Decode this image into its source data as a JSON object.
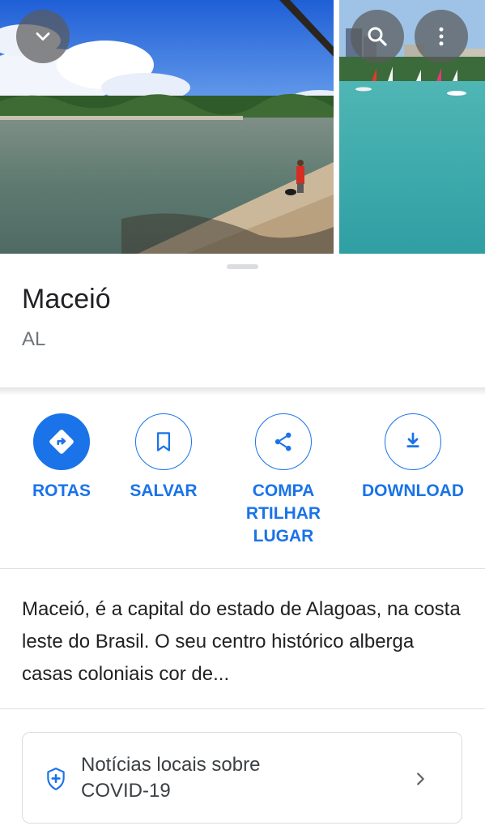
{
  "header": {
    "back_icon": "chevron-down-icon",
    "search_icon": "search-icon",
    "more_icon": "more-vert-icon"
  },
  "place": {
    "title": "Maceió",
    "subtitle": "AL"
  },
  "actions": [
    {
      "label": "ROTAS",
      "icon": "directions-icon"
    },
    {
      "label": "SALVAR",
      "icon": "bookmark-icon"
    },
    {
      "label_lines": [
        "COMPA",
        "RTILHAR",
        "LUGAR"
      ],
      "icon": "share-icon"
    },
    {
      "label": "DOWNLOAD",
      "icon": "download-icon"
    }
  ],
  "description": "Maceió, é a capital do estado de Alagoas, na costa leste do Brasil. O seu centro histórico alberga casas coloniais cor de...",
  "covid": {
    "line1": "Notícias locais sobre",
    "line2": "COVID-19",
    "icon": "shield-icon"
  },
  "colors": {
    "accent": "#1a73e8",
    "text": "#202124",
    "secondary_text": "#70757a"
  }
}
